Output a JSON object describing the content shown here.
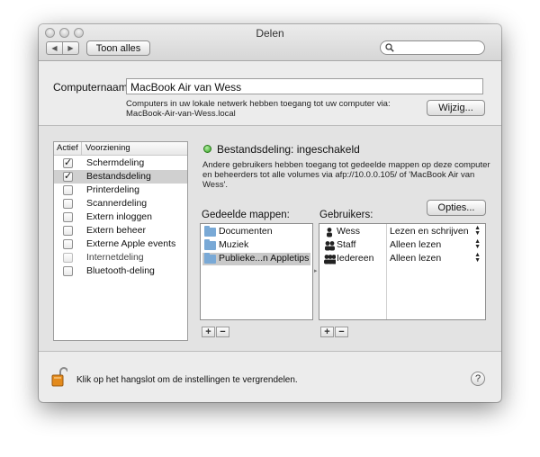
{
  "window": {
    "title": "Delen"
  },
  "toolbar": {
    "back_label": "◀",
    "forward_label": "▶",
    "show_all_label": "Toon alles",
    "search_placeholder": ""
  },
  "computer": {
    "name_label": "Computernaam:",
    "name_value": "MacBook Air van Wess",
    "info_line1": "Computers in uw lokale netwerk hebben toegang tot uw computer via:",
    "info_line2": "MacBook-Air-van-Wess.local",
    "edit_label": "Wijzig..."
  },
  "services": {
    "col_active": "Actief",
    "col_service": "Voorziening",
    "items": [
      {
        "label": "Schermdeling",
        "checked": true,
        "selected": false
      },
      {
        "label": "Bestandsdeling",
        "checked": true,
        "selected": true
      },
      {
        "label": "Printerdeling",
        "checked": false,
        "selected": false
      },
      {
        "label": "Scannerdeling",
        "checked": false,
        "selected": false
      },
      {
        "label": "Extern inloggen",
        "checked": false,
        "selected": false
      },
      {
        "label": "Extern beheer",
        "checked": false,
        "selected": false
      },
      {
        "label": "Externe Apple events",
        "checked": false,
        "selected": false
      },
      {
        "label": "Internetdeling",
        "checked": false,
        "selected": false,
        "dimmed": true
      },
      {
        "label": "Bluetooth-deling",
        "checked": false,
        "selected": false
      }
    ]
  },
  "detail": {
    "status": "Bestandsdeling: ingeschakeld",
    "description_line1": "Andere gebruikers hebben toegang tot gedeelde mappen op deze computer",
    "description_line2": "en beheerders tot alle volumes via afp://10.0.0.105/ of 'MacBook Air van",
    "description_line3": "Wess'.",
    "options_label": "Opties...",
    "folders_label": "Gedeelde mappen:",
    "users_label": "Gebruikers:",
    "folders": [
      {
        "label": "Documenten",
        "selected": false
      },
      {
        "label": "Muziek",
        "selected": false
      },
      {
        "label": "Publieke...n Appletips",
        "selected": true
      }
    ],
    "users": [
      {
        "name": "Wess",
        "permission": "Lezen en schrijven",
        "icon": "single-user-icon"
      },
      {
        "name": "Staff",
        "permission": "Alleen lezen",
        "icon": "group-icon"
      },
      {
        "name": "Iedereen",
        "permission": "Alleen lezen",
        "icon": "everyone-icon"
      }
    ],
    "plus_label": "+",
    "minus_label": "−"
  },
  "footer": {
    "lock_text": "Klik op het hangslot om de instellingen te vergrendelen.",
    "help_label": "?"
  },
  "colors": {
    "status_green": "#2fa11e",
    "folder_blue": "#79a9d6",
    "lock_orange": "#e38a1c"
  }
}
